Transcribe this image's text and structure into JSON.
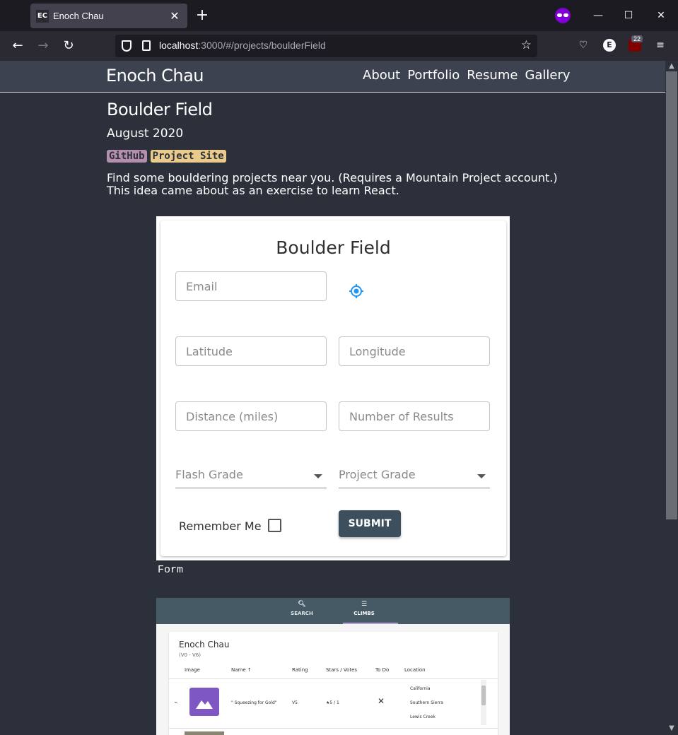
{
  "browser": {
    "tab_title": "Enoch Chau",
    "tab_favicon_text": "EC",
    "url_host": "localhost",
    "url_rest": ":3000/#/projects/boulderField",
    "extension_badge": "22"
  },
  "site": {
    "brand": "Enoch Chau",
    "nav": [
      "About",
      "Portfolio",
      "Resume",
      "Gallery"
    ]
  },
  "project": {
    "title": "Boulder Field",
    "date": "August 2020",
    "tags": [
      "GitHub",
      "Project Site"
    ],
    "description": "Find some bouldering projects near you. (Requires a Mountain Project account.) This idea came about as an exercise to learn React."
  },
  "form_screenshot": {
    "title": "Boulder Field",
    "email_placeholder": "Email",
    "latitude_placeholder": "Latitude",
    "longitude_placeholder": "Longitude",
    "distance_placeholder": "Distance (miles)",
    "results_placeholder": "Number of Results",
    "flash_grade_label": "Flash Grade",
    "project_grade_label": "Project Grade",
    "remember_label": "Remember Me",
    "submit_label": "SUBMIT",
    "caption": "Form"
  },
  "climbs_screenshot": {
    "tabs": [
      "SEARCH",
      "CLIMBS"
    ],
    "user": "Enoch Chau",
    "range": "(V0 - V6)",
    "columns": [
      "Image",
      "Name ↑",
      "Rating",
      "Stars / Votes",
      "To Do",
      "Location"
    ],
    "row": {
      "name": "\" Squeezing for Gold\"",
      "rating": "V5",
      "stars": "★5 / 1",
      "todo": "✕",
      "location": [
        "California",
        "Southern Sierra",
        "Lewis Creek"
      ]
    }
  },
  "colors": {
    "page_bg": "#2b303b",
    "header_bg": "#3c4250",
    "tag_github": "#b48ead",
    "tag_site": "#ebcb8b",
    "submit_bg": "#3d4f5c",
    "locate_icon": "#2196f3"
  }
}
